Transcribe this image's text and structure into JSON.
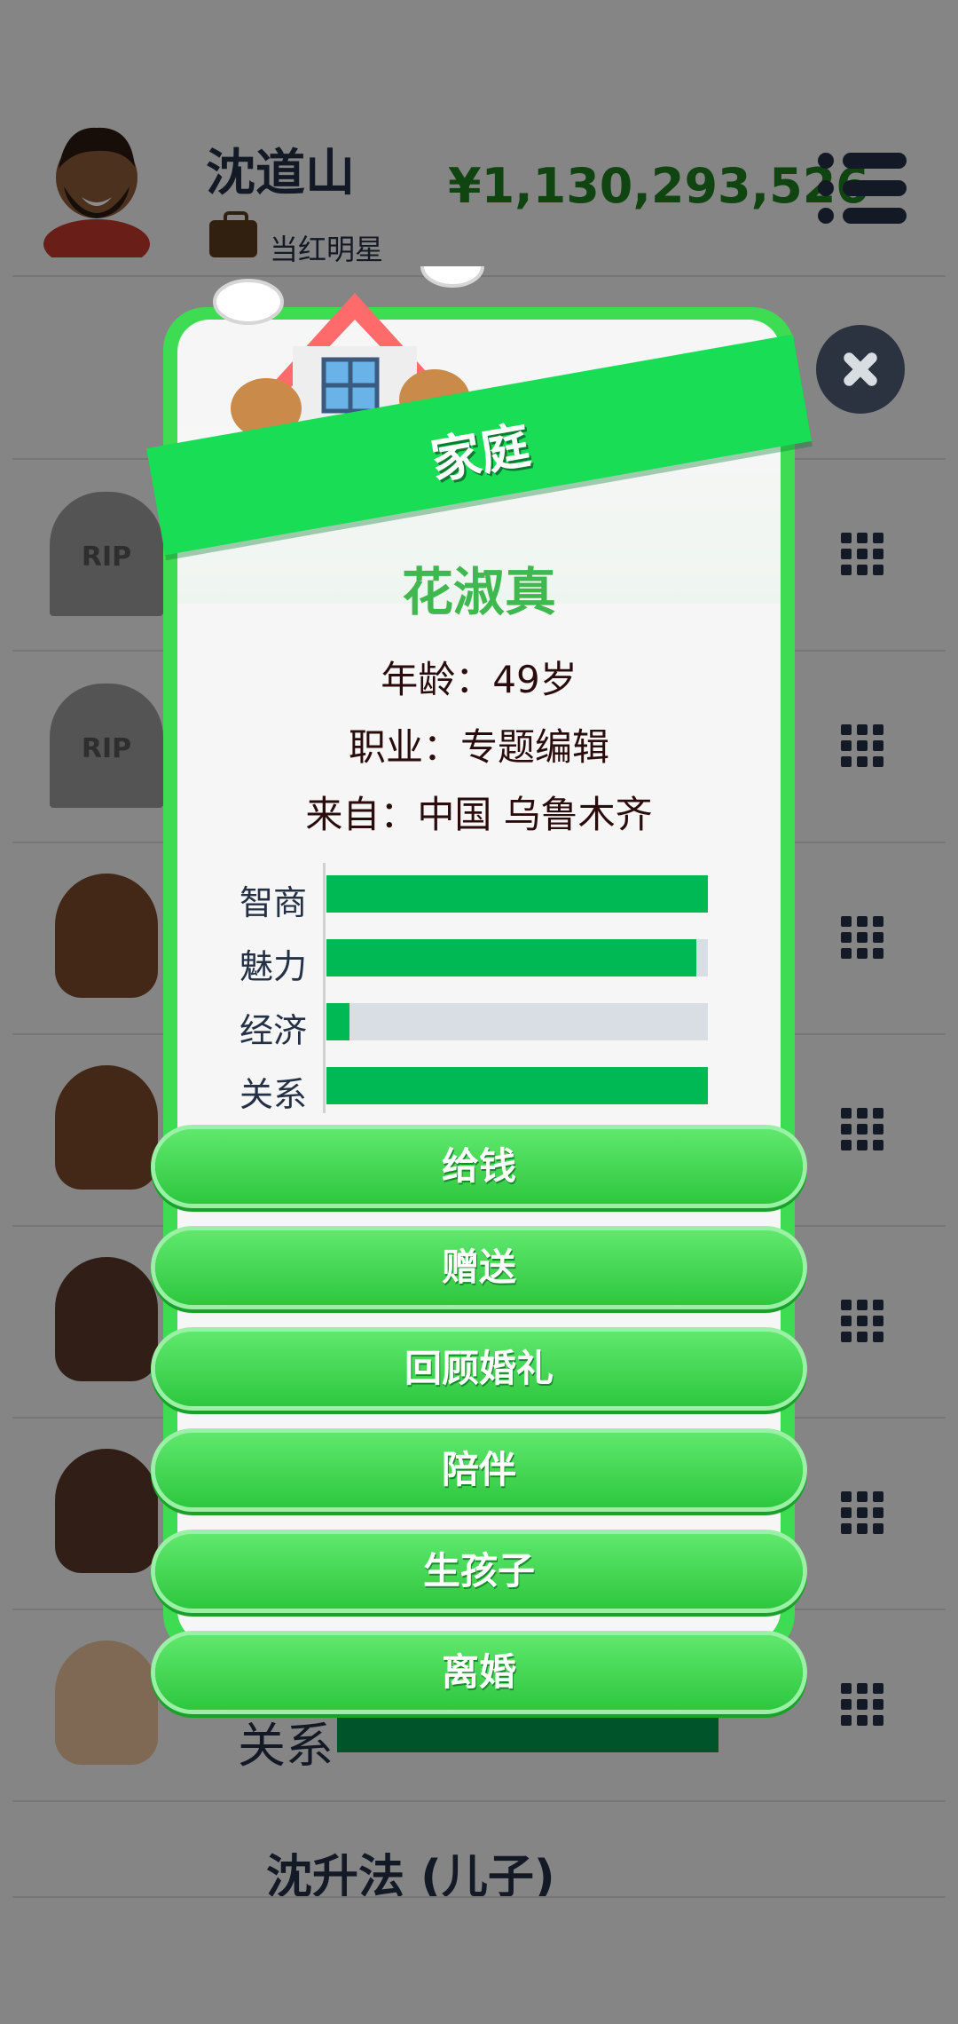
{
  "header": {
    "player_name": "沈道山",
    "job": "当红明星",
    "money": "¥1,130,293,526",
    "menu_icon": "menu-icon"
  },
  "background": {
    "rip_label": "RIP",
    "bg_stat_label": "关系",
    "bottom_name": "沈升法 (儿子)"
  },
  "modal": {
    "title": "家庭",
    "name": "花淑真",
    "age": "年龄：49岁",
    "job": "职业：专题编辑",
    "origin": "来自：中国 乌鲁木齐",
    "stats": [
      {
        "label": "智商",
        "value": 1.0
      },
      {
        "label": "魅力",
        "value": 0.97
      },
      {
        "label": "经济",
        "value": 0.06
      },
      {
        "label": "关系",
        "value": 1.0
      }
    ],
    "buttons": [
      {
        "label": "给钱"
      },
      {
        "label": "赠送"
      },
      {
        "label": "回顾婚礼"
      },
      {
        "label": "陪伴"
      },
      {
        "label": "生孩子"
      },
      {
        "label": "离婚"
      }
    ],
    "close_icon": "close-icon"
  },
  "colors": {
    "accent_green": "#19dd55",
    "money_green": "#1e7d1e",
    "stat_fill": "#00b854",
    "name_green": "#3fb84f"
  }
}
